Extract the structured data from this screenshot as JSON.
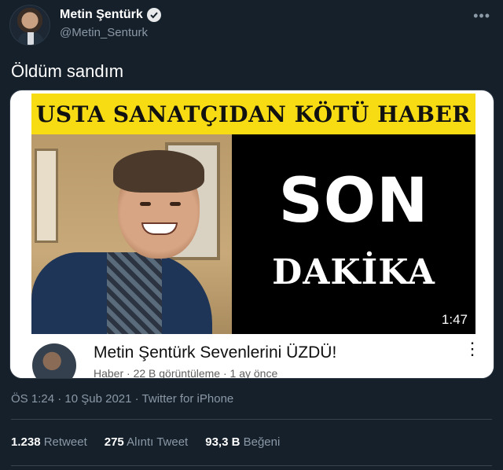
{
  "user": {
    "name": "Metin Şentürk",
    "handle": "@Metin_Senturk",
    "more_icon": "more-horizontal-icon"
  },
  "tweet": {
    "text": "Öldüm sandım"
  },
  "card": {
    "banner": "USTA SANATÇIDAN KÖTÜ HABER",
    "headline_big": "SON",
    "headline_small": "DAKİKA",
    "duration": "1:47",
    "video_title": "Metin Şentürk Sevenlerini ÜZDÜ!",
    "video_meta": "Haber · 22 B görüntüleme · 1 ay önce"
  },
  "meta": {
    "time": "ÖS 1:24",
    "date": "10 Şub 2021",
    "source": "Twitter for iPhone"
  },
  "stats": {
    "retweets_count": "1.238",
    "retweets_label": "Retweet",
    "quotes_count": "275",
    "quotes_label": "Alıntı Tweet",
    "likes_count": "93,3 B",
    "likes_label": "Beğeni"
  },
  "colors": {
    "background": "#15202b",
    "secondary_text": "#8b98a5",
    "banner_yellow": "#f7dc14"
  }
}
